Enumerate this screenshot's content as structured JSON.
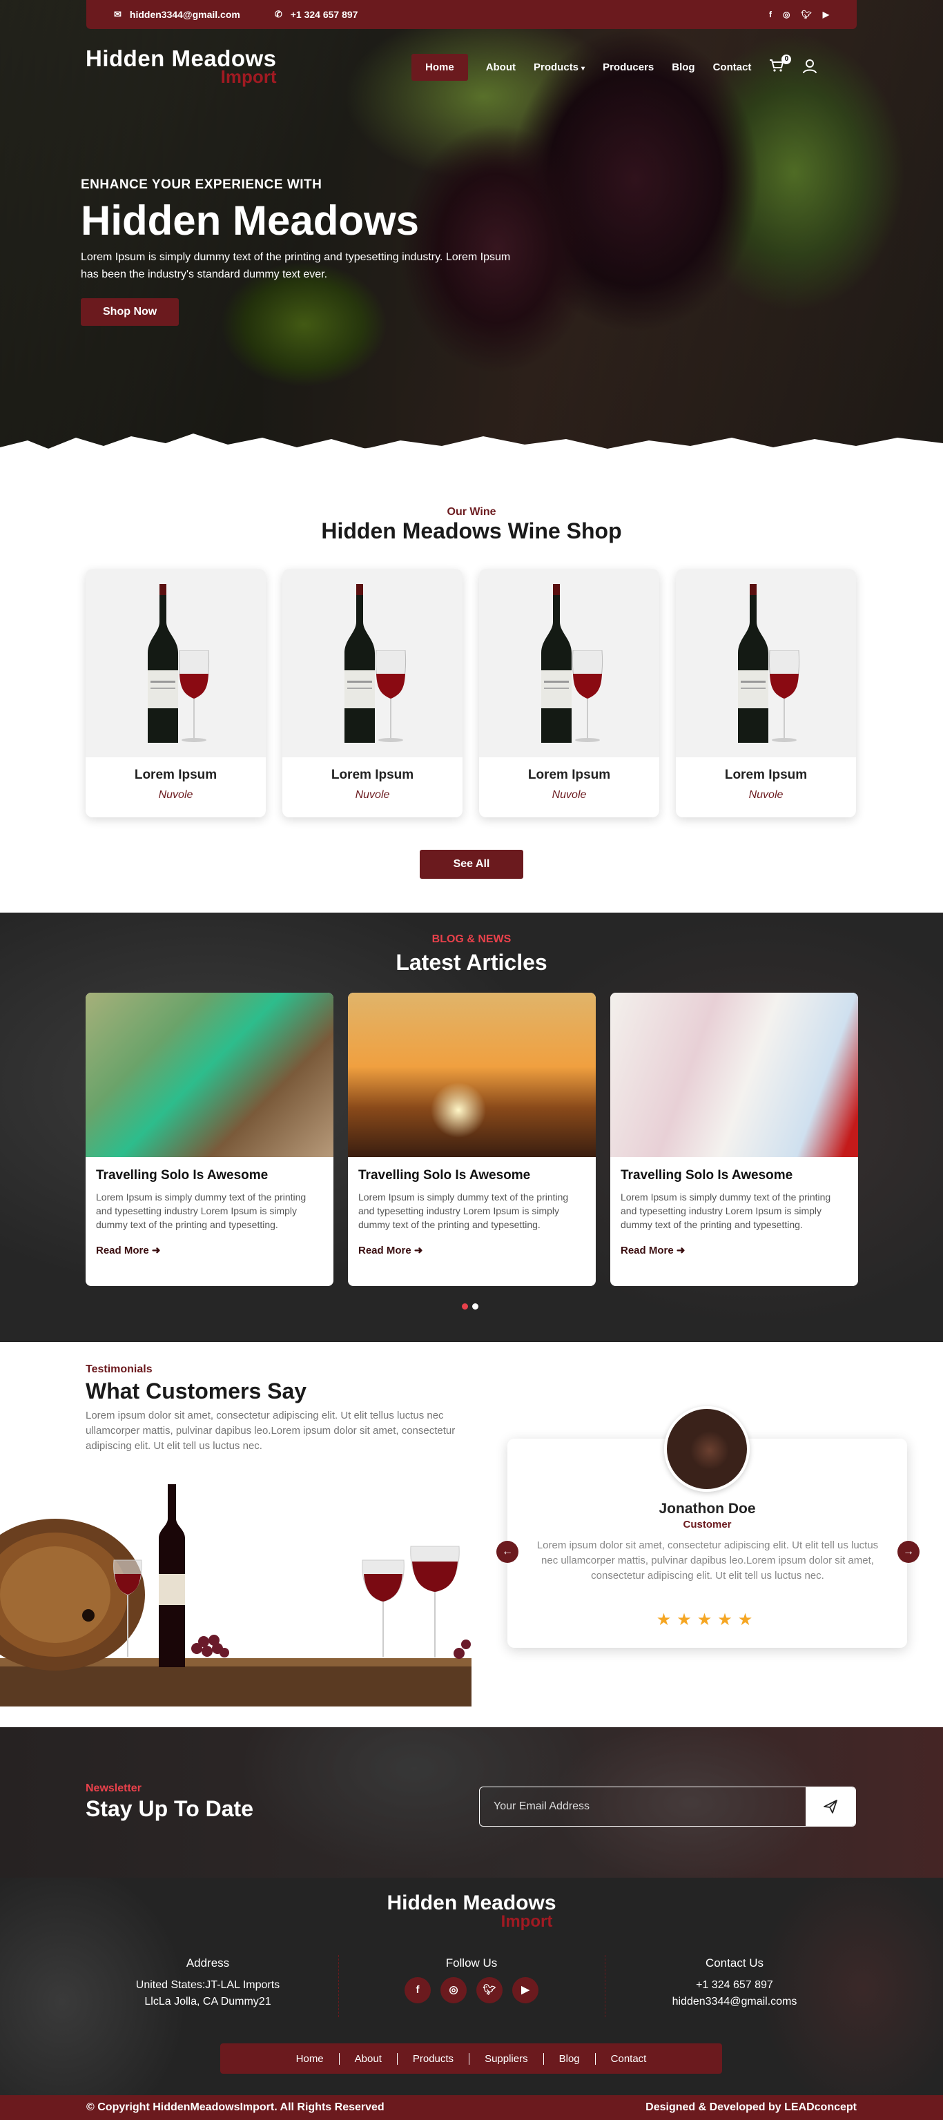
{
  "topbar": {
    "email": "hidden3344@gmail.com",
    "phone": "+1 324 657 897",
    "social_icons": [
      "facebook-icon",
      "instagram-icon",
      "twitter-icon",
      "youtube-icon"
    ]
  },
  "header": {
    "logo_line1": "Hidden Meadows",
    "logo_line2": "Import",
    "nav": [
      "Home",
      "About",
      "Products",
      "Producers",
      "Blog",
      "Contact"
    ],
    "cart_count": "0"
  },
  "hero": {
    "eyebrow": "ENHANCE YOUR EXPERIENCE WITH",
    "title": "Hidden Meadows",
    "text": "Lorem Ipsum is simply dummy text of the printing and typesetting industry. Lorem Ipsum has been the industry's standard dummy text ever.",
    "button": "Shop Now"
  },
  "shop": {
    "subtitle": "Our Wine",
    "title": "Hidden Meadows Wine Shop",
    "products": [
      {
        "name": "Lorem Ipsum",
        "sub": "Nuvole"
      },
      {
        "name": "Lorem Ipsum",
        "sub": "Nuvole"
      },
      {
        "name": "Lorem Ipsum",
        "sub": "Nuvole"
      },
      {
        "name": "Lorem Ipsum",
        "sub": "Nuvole"
      }
    ],
    "see_all": "See All"
  },
  "blog": {
    "subtitle": "BLOG & NEWS",
    "title": "Latest Articles",
    "articles": [
      {
        "title": "Travelling Solo Is Awesome",
        "text": "Lorem Ipsum is simply dummy text of the printing and typesetting industry Lorem Ipsum is simply dummy text of the printing and typesetting.",
        "link": "Read More"
      },
      {
        "title": "Travelling Solo Is Awesome",
        "text": "Lorem Ipsum is simply dummy text of the printing and typesetting industry Lorem Ipsum is simply dummy text of the printing and typesetting.",
        "link": "Read More"
      },
      {
        "title": "Travelling Solo Is Awesome",
        "text": "Lorem Ipsum is simply dummy text of the printing and typesetting industry Lorem Ipsum is simply dummy text of the printing and typesetting.",
        "link": "Read More"
      }
    ]
  },
  "testimonials": {
    "subtitle": "Testimonials",
    "title": "What Customers Say",
    "intro": "Lorem ipsum dolor sit amet, consectetur adipiscing elit. Ut elit tellus luctus nec ullamcorper mattis, pulvinar dapibus leo.Lorem ipsum dolor sit amet, consectetur adipiscing elit. Ut elit tell us luctus nec.",
    "name": "Jonathon Doe",
    "role": "Customer",
    "quote": "Lorem ipsum dolor sit amet, consectetur adipiscing elit. Ut elit tell us luctus nec ullamcorper mattis, pulvinar dapibus leo.Lorem ipsum dolor sit amet, consectetur adipiscing elit. Ut elit tell us luctus nec.",
    "stars": "★★★★★",
    "rating": 5
  },
  "newsletter": {
    "subtitle": "Newsletter",
    "title": "Stay Up To Date",
    "placeholder": "Your Email Address"
  },
  "footer": {
    "logo_line1": "Hidden Meadows",
    "logo_line2": "Import",
    "address_title": "Address",
    "address_line1": "United States:JT-LAL Imports",
    "address_line2": "LlcLa Jolla, CA Dummy21",
    "follow_title": "Follow Us",
    "contact_title": "Contact Us",
    "contact_phone": "+1 324 657 897",
    "contact_email": "hidden3344@gmail.coms",
    "nav": [
      "Home",
      "About",
      "Products",
      "Suppliers",
      "Blog",
      "Contact"
    ],
    "copyright": "© Copyright HiddenMeadowsImport. All Rights Reserved",
    "credit": "Designed & Developed by LEADconcept"
  }
}
